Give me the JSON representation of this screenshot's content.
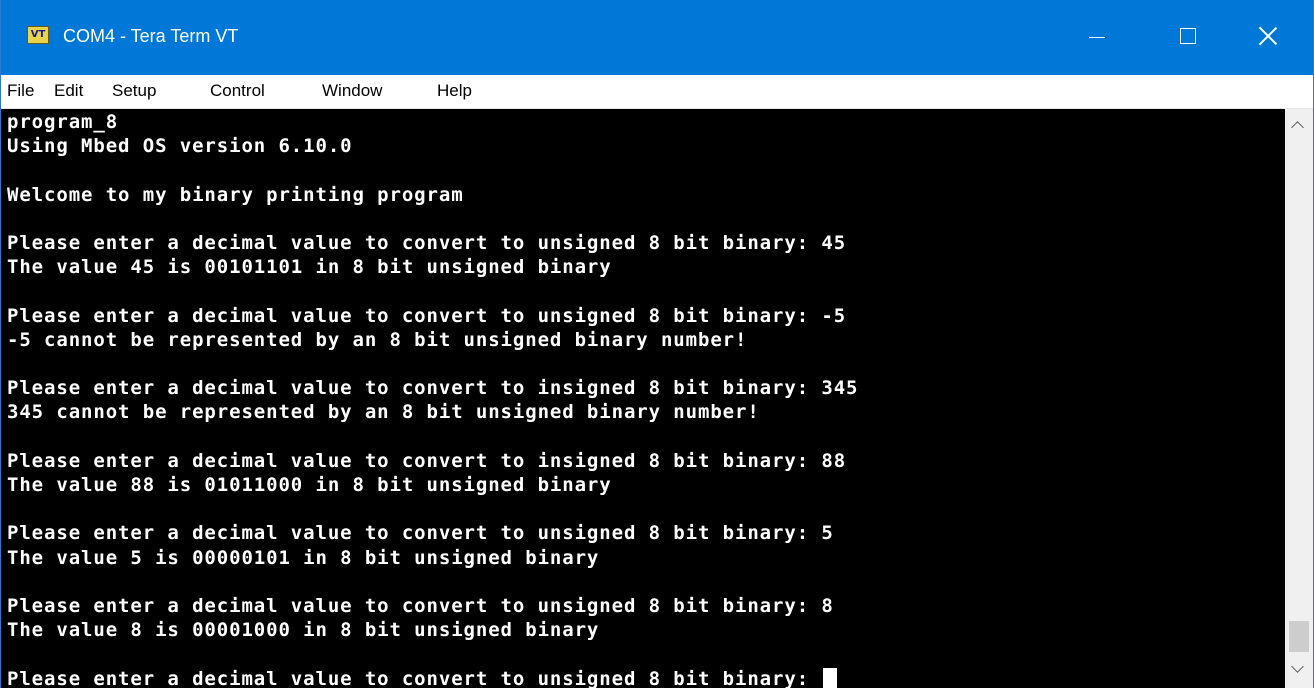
{
  "window": {
    "app_icon": "VT",
    "title": "COM4 - Tera Term VT",
    "controls": {
      "minimize_icon": "minimize-icon",
      "maximize_icon": "maximize-icon",
      "close_icon": "close-icon"
    }
  },
  "menu": {
    "file": "File",
    "edit": "Edit",
    "setup": "Setup",
    "control": "Control",
    "window": "Window",
    "help": "Help"
  },
  "terminal": {
    "lines": [
      "program_8",
      "Using Mbed OS version 6.10.0",
      "",
      "Welcome to my binary printing program",
      "",
      "Please enter a decimal value to convert to unsigned 8 bit binary: 45",
      "The value 45 is 00101101 in 8 bit unsigned binary",
      "",
      "Please enter a decimal value to convert to unsigned 8 bit binary: -5",
      "-5 cannot be represented by an 8 bit unsigned binary number!",
      "",
      "Please enter a decimal value to convert to insigned 8 bit binary: 345",
      "345 cannot be represented by an 8 bit unsigned binary number!",
      "",
      "Please enter a decimal value to convert to insigned 8 bit binary: 88",
      "The value 88 is 01011000 in 8 bit unsigned binary",
      "",
      "Please enter a decimal value to convert to unsigned 8 bit binary: 5",
      "The value 5 is 00000101 in 8 bit unsigned binary",
      "",
      "Please enter a decimal value to convert to unsigned 8 bit binary: 8",
      "The value 8 is 00001000 in 8 bit unsigned binary",
      "",
      "Please enter a decimal value to convert to unsigned 8 bit binary: "
    ],
    "foreground": "#ffffff",
    "background": "#000000"
  },
  "colors": {
    "titlebar": "#0078d7",
    "menubar": "#ffffff",
    "scrollbar_track": "#f0f0f0",
    "scrollbar_thumb": "#cdcdcd"
  }
}
